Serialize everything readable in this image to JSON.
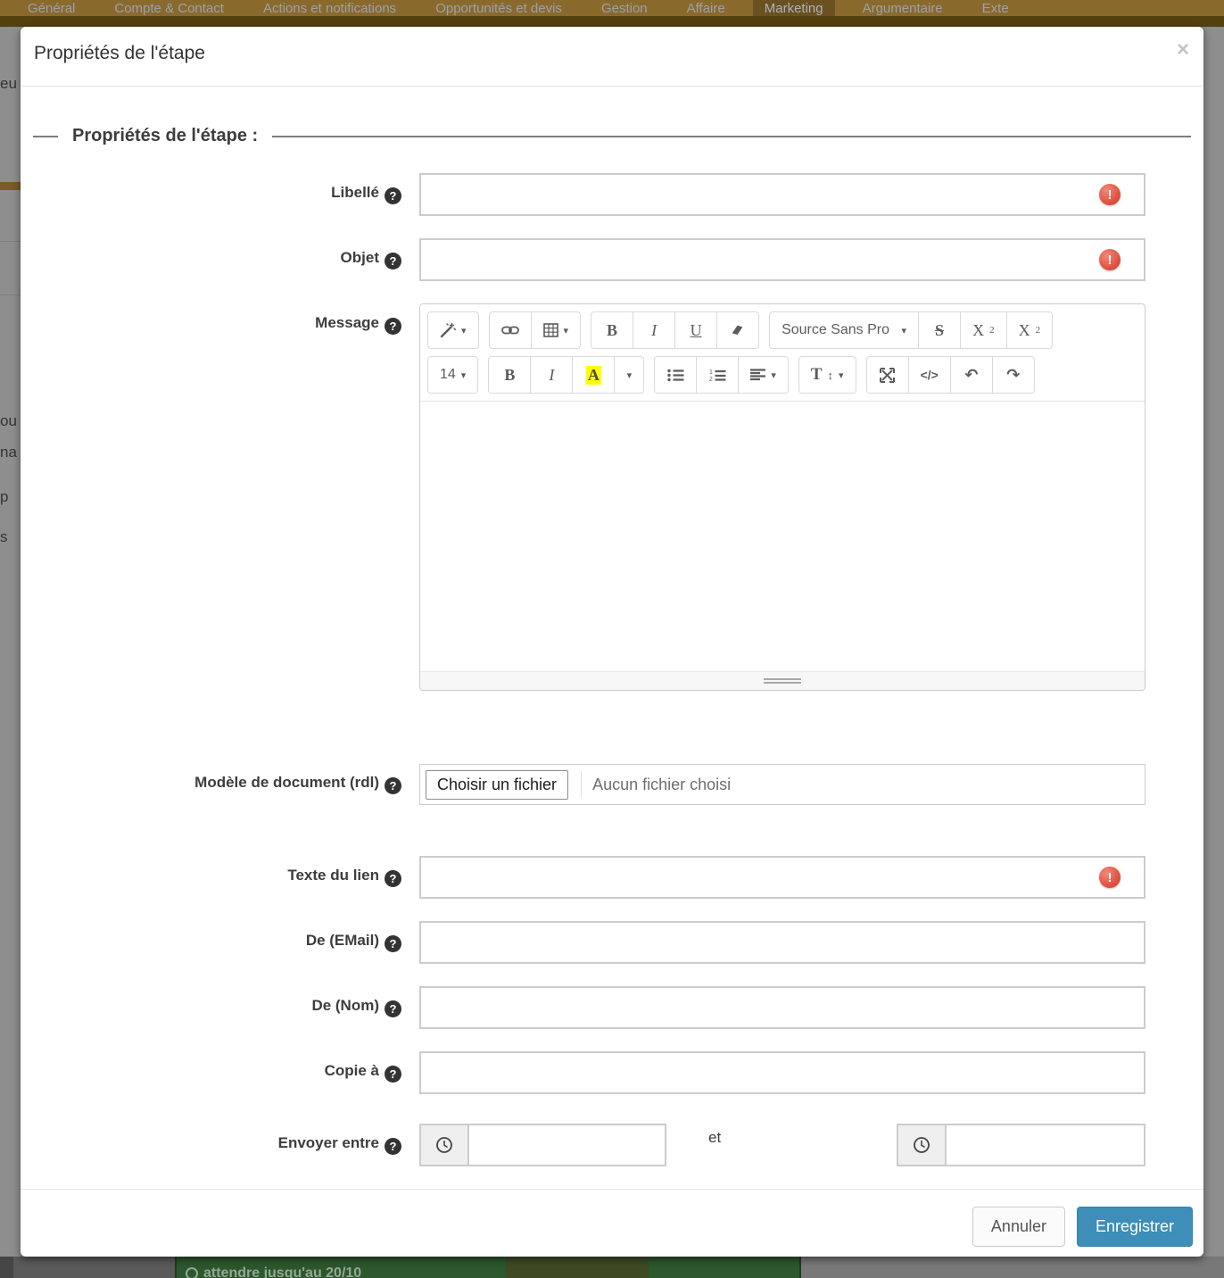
{
  "nav": {
    "tabs": [
      "Général",
      "Compte & Contact",
      "Actions et notifications",
      "Opportunités et devis",
      "Gestion",
      "Affaire",
      "Marketing",
      "Argumentaire",
      "Exte"
    ],
    "active_tab": "Marketing"
  },
  "modal": {
    "title": "Propriétés de l'étape",
    "close": "×",
    "legend": "Propriétés de l'étape :"
  },
  "fields": {
    "libelle": {
      "label": "Libellé",
      "value": "",
      "has_error": true
    },
    "objet": {
      "label": "Objet",
      "value": "",
      "has_error": true
    },
    "message": {
      "label": "Message",
      "value": ""
    },
    "modele": {
      "label": "Modèle de document (rdl)",
      "button": "Choisir un fichier",
      "status": "Aucun fichier choisi"
    },
    "lien": {
      "label": "Texte du lien",
      "value": "",
      "has_error": true
    },
    "email": {
      "label": "De (EMail)",
      "value": ""
    },
    "nom": {
      "label": "De (Nom)",
      "value": ""
    },
    "copie": {
      "label": "Copie à",
      "value": ""
    },
    "envoyer": {
      "label": "Envoyer entre",
      "separator": "et",
      "from_value": "",
      "to_value": ""
    }
  },
  "editor": {
    "font_name": "Source Sans Pro",
    "font_size": "14",
    "bold": "B",
    "italic": "I",
    "underline": "U",
    "strike": "S",
    "script_base": "X",
    "script_digit": "2",
    "color_letter": "A",
    "lineheight_letter": "T",
    "lineheight_arrow": "↕",
    "code_label": "</>",
    "undo": "↶",
    "redo": "↷",
    "caret": "▾"
  },
  "icons": {
    "help": "?",
    "error": "!"
  },
  "footer": {
    "cancel": "Annuler",
    "save": "Enregistrer"
  },
  "background": {
    "fragments": [
      "eu",
      "ou",
      "na",
      "p",
      "s"
    ],
    "bottom_text": "attendre jusqu'au 20/10"
  },
  "colors": {
    "accent_blue": "#3d8eb9",
    "error_red": "#e05142",
    "navbar_bg": "#8a692d",
    "navbar_active_bg": "#6b5122",
    "highlight_yellow": "#ffff00",
    "behind_green": "#2d572d"
  }
}
